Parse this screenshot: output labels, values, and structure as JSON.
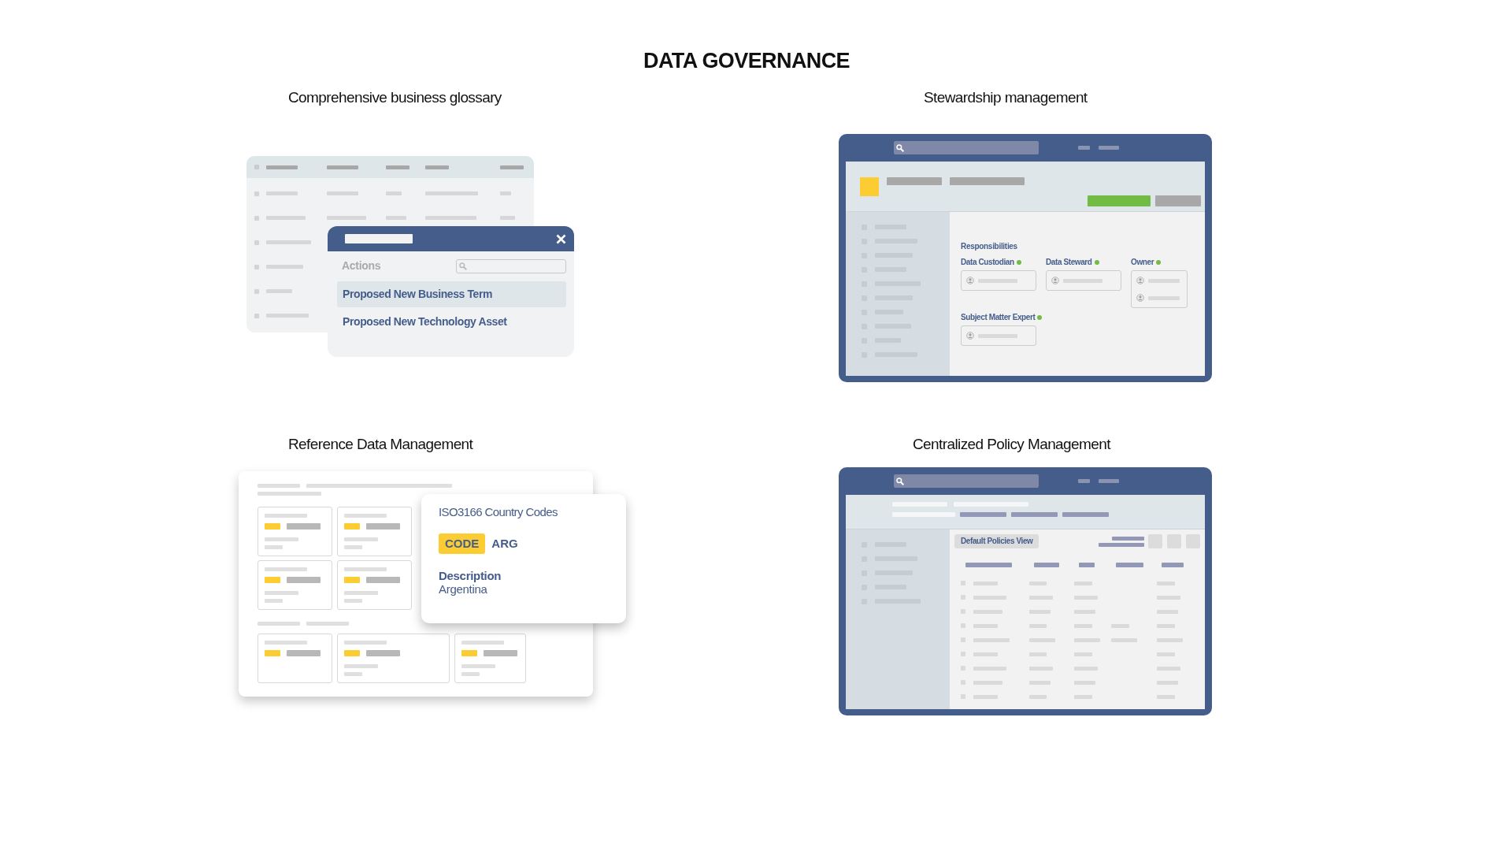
{
  "title": "DATA GOVERNANCE",
  "panels": [
    {
      "kind": "glossary",
      "heading": "Comprehensive business glossary",
      "popup": {
        "label": "Actions",
        "items": [
          {
            "text": "Proposed New Business Term",
            "selected": true
          },
          {
            "text": "Proposed New Technology Asset",
            "selected": false
          }
        ]
      }
    },
    {
      "kind": "stewardship",
      "heading": "Stewardship management",
      "section": "Responsibilities",
      "roles": [
        {
          "name": "Data Custodian",
          "kind": "single"
        },
        {
          "name": "Data Steward",
          "kind": "single"
        },
        {
          "name": "Owner",
          "kind": "double"
        },
        {
          "name": "Subject Matter Expert",
          "kind": "single"
        }
      ]
    },
    {
      "kind": "reference",
      "heading": "Reference Data Management",
      "card": {
        "title": "ISO3166 Country Codes",
        "code_label": "CODE",
        "code_value": "ARG",
        "description_label": "Description",
        "description_value": "Argentina"
      }
    },
    {
      "kind": "policy",
      "heading": "Centralized Policy Management",
      "view_label": "Default Policies View"
    }
  ]
}
